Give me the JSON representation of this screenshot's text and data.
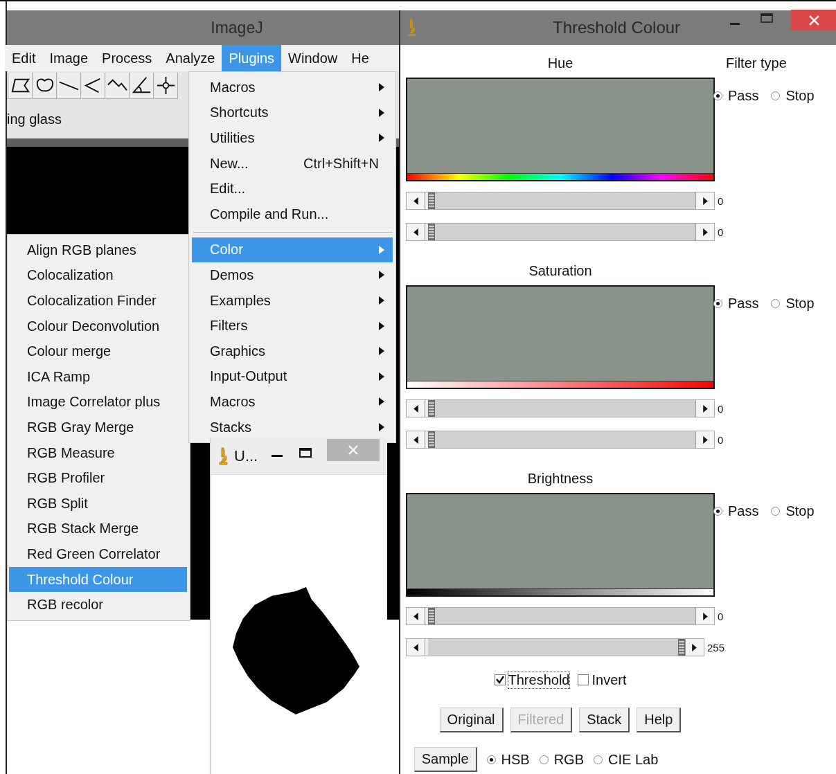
{
  "imagej": {
    "title": "ImageJ",
    "menus": [
      {
        "label": "Edit",
        "selected": false
      },
      {
        "label": "Image",
        "selected": false
      },
      {
        "label": "Process",
        "selected": false
      },
      {
        "label": "Analyze",
        "selected": false
      },
      {
        "label": "Plugins",
        "selected": true
      },
      {
        "label": "Window",
        "selected": false
      },
      {
        "label": "He",
        "selected": false
      }
    ],
    "status": "ing glass"
  },
  "plugins_menu": [
    {
      "kind": "item",
      "label": "Macros",
      "submenu": true,
      "selected": false
    },
    {
      "kind": "item",
      "label": "Shortcuts",
      "submenu": true,
      "selected": false
    },
    {
      "kind": "item",
      "label": "Utilities",
      "submenu": true,
      "selected": false
    },
    {
      "kind": "item",
      "label": "New...",
      "shortcut": "Ctrl+Shift+N",
      "submenu": false,
      "selected": false
    },
    {
      "kind": "item",
      "label": "Edit...",
      "submenu": false,
      "selected": false
    },
    {
      "kind": "item",
      "label": "Compile and Run...",
      "submenu": false,
      "selected": false
    },
    {
      "kind": "separator"
    },
    {
      "kind": "item",
      "label": "Color",
      "submenu": true,
      "selected": true
    },
    {
      "kind": "item",
      "label": "Demos",
      "submenu": true,
      "selected": false
    },
    {
      "kind": "item",
      "label": "Examples",
      "submenu": true,
      "selected": false
    },
    {
      "kind": "item",
      "label": "Filters",
      "submenu": true,
      "selected": false
    },
    {
      "kind": "item",
      "label": "Graphics",
      "submenu": true,
      "selected": false
    },
    {
      "kind": "item",
      "label": "Input-Output",
      "submenu": true,
      "selected": false
    },
    {
      "kind": "item",
      "label": "Macros",
      "submenu": true,
      "selected": false
    },
    {
      "kind": "item",
      "label": "Stacks",
      "submenu": true,
      "selected": false
    }
  ],
  "color_submenu": [
    {
      "label": "Align RGB planes",
      "selected": false
    },
    {
      "label": "Colocalization",
      "selected": false
    },
    {
      "label": "Colocalization Finder",
      "selected": false
    },
    {
      "label": "Colour Deconvolution",
      "selected": false
    },
    {
      "label": "Colour merge",
      "selected": false
    },
    {
      "label": "ICA Ramp",
      "selected": false
    },
    {
      "label": "Image Correlator plus",
      "selected": false
    },
    {
      "label": "RGB Gray Merge",
      "selected": false
    },
    {
      "label": "RGB Measure",
      "selected": false
    },
    {
      "label": "RGB Profiler",
      "selected": false
    },
    {
      "label": "RGB Split",
      "selected": false
    },
    {
      "label": "RGB Stack Merge",
      "selected": false
    },
    {
      "label": "Red Green Correlator",
      "selected": false
    },
    {
      "label": "Threshold Colour",
      "selected": true
    },
    {
      "label": "RGB recolor",
      "selected": false
    }
  ],
  "image_window": {
    "title": "U..."
  },
  "threshold_window": {
    "title": "Threshold Colour",
    "filter_type_label": "Filter type",
    "channels": [
      {
        "kind": "hue",
        "label": "Hue",
        "sliders": [
          {
            "level": 0,
            "reading": "0"
          },
          {
            "level": 0,
            "reading": "0"
          }
        ],
        "filter": [
          {
            "label": "Pass",
            "selected": true
          },
          {
            "label": "Stop",
            "selected": false
          }
        ]
      },
      {
        "kind": "saturation",
        "label": "Saturation",
        "sliders": [
          {
            "level": 0,
            "reading": "0"
          },
          {
            "level": 0,
            "reading": "0"
          }
        ],
        "filter": [
          {
            "label": "Pass",
            "selected": true
          },
          {
            "label": "Stop",
            "selected": false
          }
        ]
      },
      {
        "kind": "brightness",
        "label": "Brightness",
        "sliders": [
          {
            "level": 0,
            "reading": "0"
          },
          {
            "level": 1,
            "reading": "255"
          }
        ],
        "filter": [
          {
            "label": "Pass",
            "selected": true
          },
          {
            "label": "Stop",
            "selected": false
          }
        ]
      }
    ],
    "checkboxes": [
      {
        "label": "Threshold",
        "checked": true
      },
      {
        "label": "Invert",
        "checked": false
      }
    ],
    "buttons": [
      {
        "label": "Original",
        "disabled": false
      },
      {
        "label": "Filtered",
        "disabled": true
      },
      {
        "label": "Stack",
        "disabled": false
      },
      {
        "label": "Help",
        "disabled": false
      }
    ],
    "sample_button": "Sample",
    "color_spaces": [
      {
        "label": "HSB",
        "selected": true
      },
      {
        "label": "RGB",
        "selected": false
      },
      {
        "label": "CIE Lab",
        "selected": false
      }
    ]
  }
}
